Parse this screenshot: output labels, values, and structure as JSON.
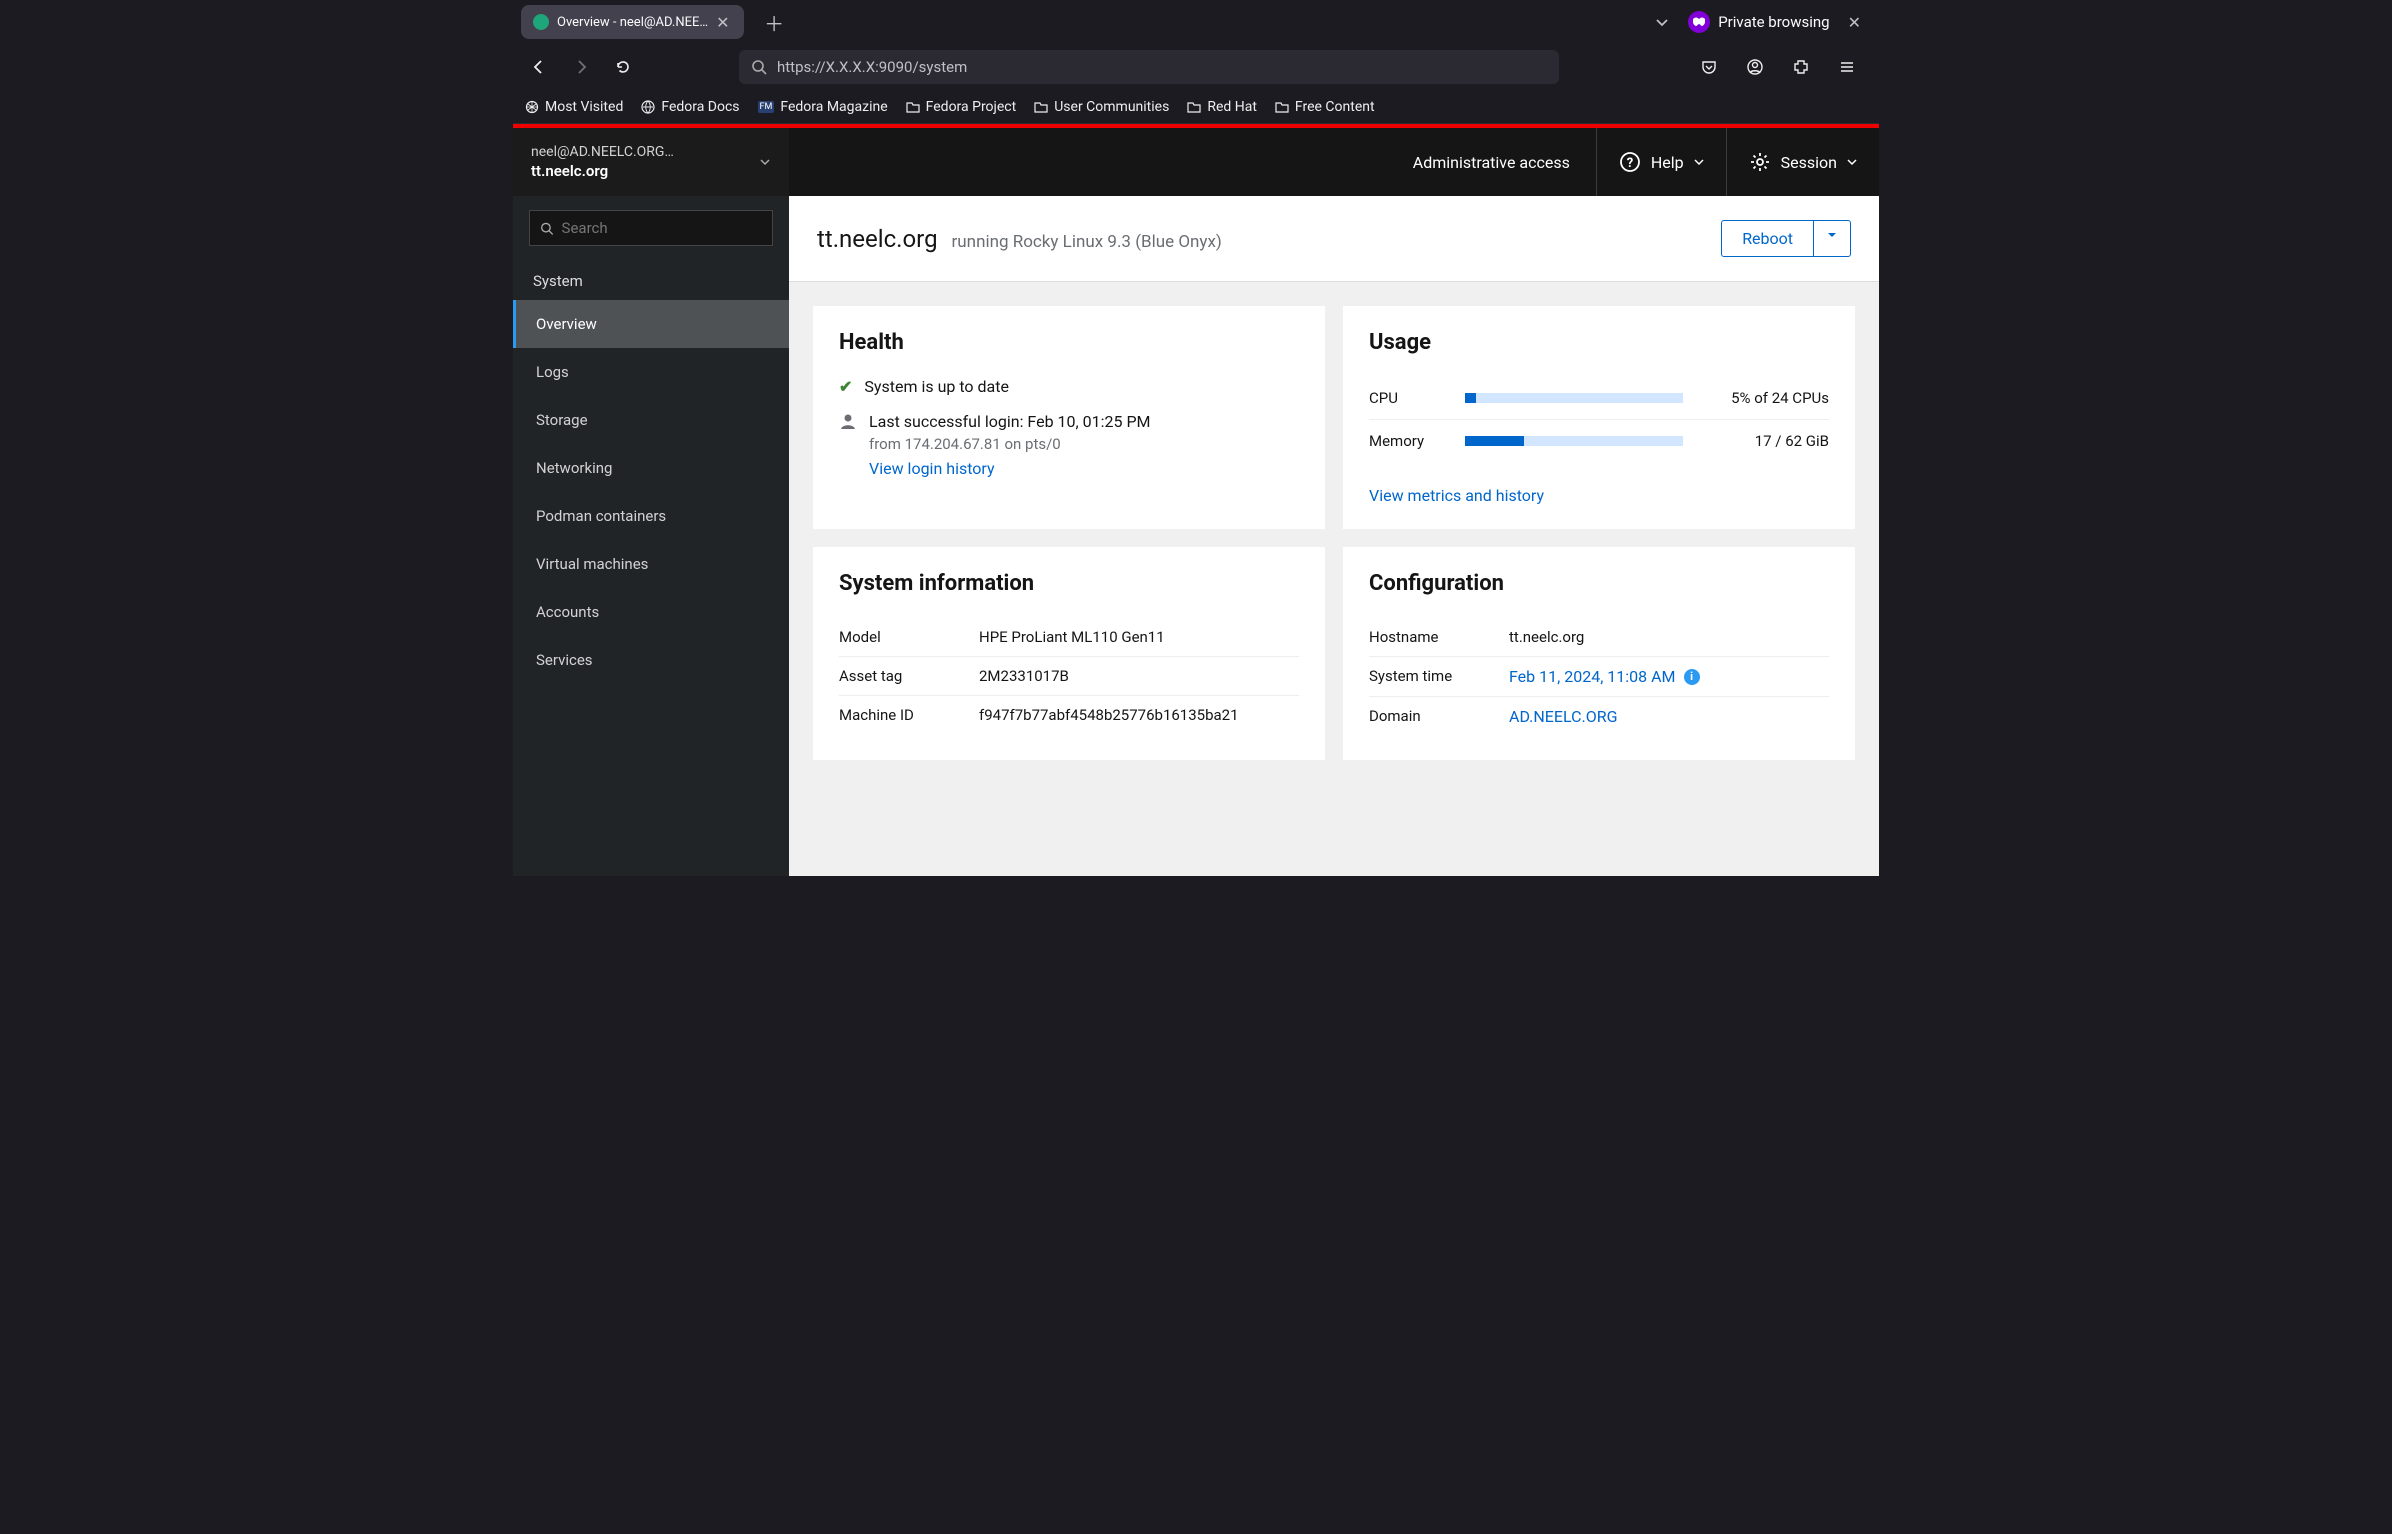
{
  "browser": {
    "tab_title": "Overview - neel@AD.NEE…",
    "url": "https://X.X.X.X:9090/system",
    "private_label": "Private browsing",
    "bookmarks": [
      "Most Visited",
      "Fedora Docs",
      "Fedora Magazine",
      "Fedora Project",
      "User Communities",
      "Red Hat",
      "Free Content"
    ]
  },
  "masthead": {
    "host_sub": "neel@AD.NEELC.ORG…",
    "host_main": "tt.neelc.org",
    "admin_access": "Administrative access",
    "help": "Help",
    "session": "Session"
  },
  "sidebar": {
    "search_placeholder": "Search",
    "group_label": "System",
    "items": [
      "Overview",
      "Logs",
      "Storage",
      "Networking",
      "Podman containers",
      "Virtual machines",
      "Accounts",
      "Services"
    ],
    "active": "Overview"
  },
  "header": {
    "hostname": "tt.neelc.org",
    "subhead": "running Rocky Linux 9.3 (Blue Onyx)",
    "reboot_label": "Reboot"
  },
  "health": {
    "title": "Health",
    "status": "System is up to date",
    "login_line": "Last successful login: Feb 10, 01:25 PM",
    "login_sub": "from 174.204.67.81 on pts/0",
    "login_link": "View login history"
  },
  "usage": {
    "title": "Usage",
    "rows": [
      {
        "label": "CPU",
        "pct": 5,
        "text": "5% of 24 CPUs"
      },
      {
        "label": "Memory",
        "pct": 27,
        "text": "17 / 62 GiB"
      }
    ],
    "metrics_link": "View metrics and history"
  },
  "sysinfo": {
    "title": "System information",
    "rows": [
      {
        "label": "Model",
        "value": "HPE ProLiant ML110 Gen11"
      },
      {
        "label": "Asset tag",
        "value": "2M2331017B"
      },
      {
        "label": "Machine ID",
        "value": "f947f7b77abf4548b25776b16135ba21"
      }
    ]
  },
  "config": {
    "title": "Configuration",
    "rows": [
      {
        "label": "Hostname",
        "value": "tt.neelc.org",
        "link": false
      },
      {
        "label": "System time",
        "value": "Feb 11, 2024, 11:08 AM",
        "link": true,
        "info": true
      },
      {
        "label": "Domain",
        "value": "AD.NEELC.ORG",
        "link": true
      }
    ]
  }
}
